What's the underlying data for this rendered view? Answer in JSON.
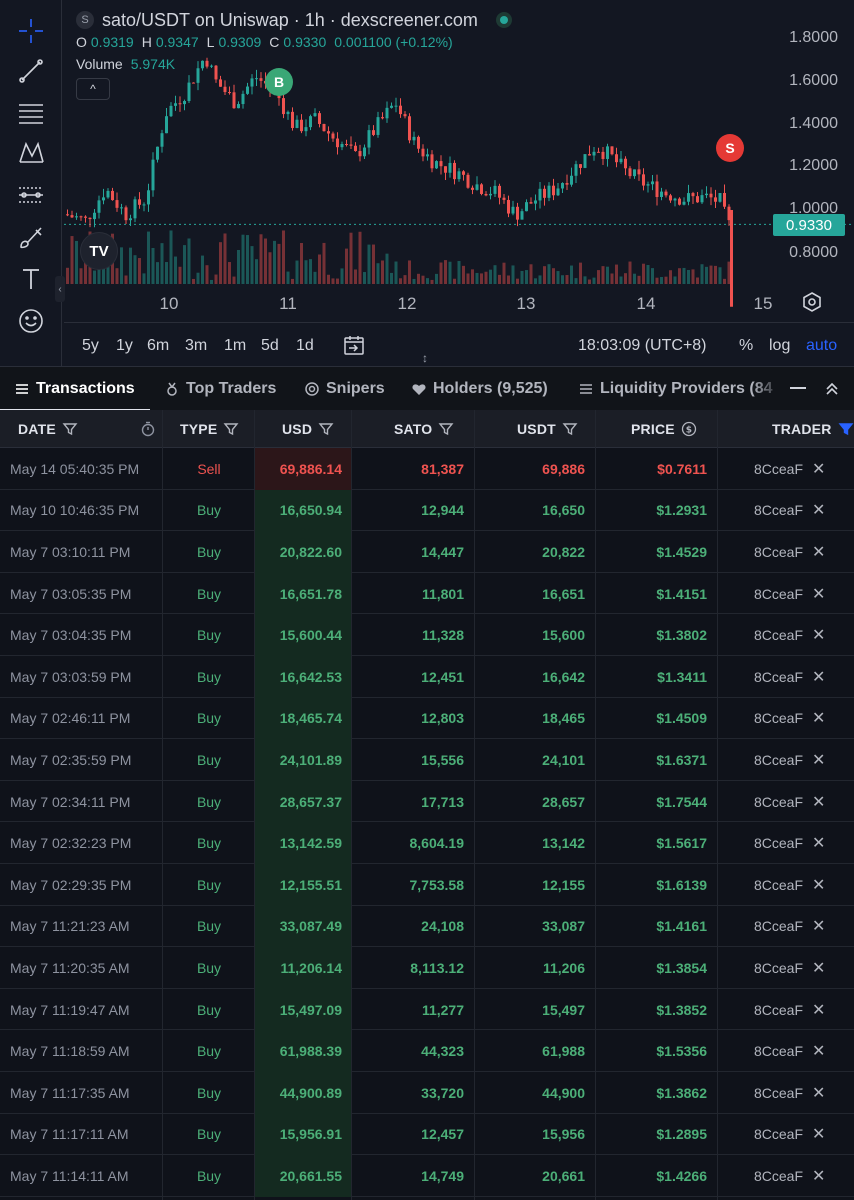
{
  "chart": {
    "title": "sato/USDT on Uniswap · 1h · dexscreener.com",
    "symbol_icon_letter": "S",
    "ohlc": [
      {
        "k": "O",
        "v": "0.9319"
      },
      {
        "k": "H",
        "v": "0.9347"
      },
      {
        "k": "L",
        "v": "0.9309"
      },
      {
        "k": "C",
        "v": "0.9330"
      },
      {
        "k": "",
        "v": "0.001100 (+0.12%)"
      }
    ],
    "volume_label": "Volume",
    "volume_value": "5.974K",
    "legend_toggle": "^",
    "logo_text": "TV",
    "y_axis": [
      "1.8000",
      "1.6000",
      "1.4000",
      "1.2000",
      "1.0000",
      "0.8000"
    ],
    "current_price": "0.9330",
    "x_axis": [
      "10",
      "11",
      "12",
      "13",
      "14",
      "15"
    ],
    "marker_buy": "B",
    "marker_sell": "S",
    "ranges": [
      "5y",
      "1y",
      "6m",
      "3m",
      "1m",
      "5d",
      "1d"
    ],
    "time": "18:03:09 (UTC+8)",
    "percent": "%",
    "log": "log",
    "auto": "auto",
    "colors": {
      "up": "#26a69a",
      "down": "#ef5350",
      "accent": "#2962ff"
    }
  },
  "tabs": [
    {
      "label": "Transactions",
      "icon": "transactions-icon"
    },
    {
      "label": "Top Traders",
      "icon": "medal-icon"
    },
    {
      "label": "Snipers",
      "icon": "target-icon"
    },
    {
      "label": "Holders (9,525)",
      "icon": "heart-icon"
    },
    {
      "label": "Liquidity Providers (84",
      "icon": "liquidity-icon"
    }
  ],
  "table": {
    "headers": [
      "DATE",
      "TYPE",
      "USD",
      "SATO",
      "USDT",
      "PRICE",
      "TRADER"
    ],
    "rows": [
      {
        "date": "May 14 05:40:35 PM",
        "type": "Sell",
        "usd": "69,886.14",
        "sato": "81,387",
        "usdt": "69,886",
        "price": "$0.7611",
        "trader": "8CceaF"
      },
      {
        "date": "May 10 10:46:35 PM",
        "type": "Buy",
        "usd": "16,650.94",
        "sato": "12,944",
        "usdt": "16,650",
        "price": "$1.2931",
        "trader": "8CceaF"
      },
      {
        "date": "May 7 03:10:11 PM",
        "type": "Buy",
        "usd": "20,822.60",
        "sato": "14,447",
        "usdt": "20,822",
        "price": "$1.4529",
        "trader": "8CceaF"
      },
      {
        "date": "May 7 03:05:35 PM",
        "type": "Buy",
        "usd": "16,651.78",
        "sato": "11,801",
        "usdt": "16,651",
        "price": "$1.4151",
        "trader": "8CceaF"
      },
      {
        "date": "May 7 03:04:35 PM",
        "type": "Buy",
        "usd": "15,600.44",
        "sato": "11,328",
        "usdt": "15,600",
        "price": "$1.3802",
        "trader": "8CceaF"
      },
      {
        "date": "May 7 03:03:59 PM",
        "type": "Buy",
        "usd": "16,642.53",
        "sato": "12,451",
        "usdt": "16,642",
        "price": "$1.3411",
        "trader": "8CceaF"
      },
      {
        "date": "May 7 02:46:11 PM",
        "type": "Buy",
        "usd": "18,465.74",
        "sato": "12,803",
        "usdt": "18,465",
        "price": "$1.4509",
        "trader": "8CceaF"
      },
      {
        "date": "May 7 02:35:59 PM",
        "type": "Buy",
        "usd": "24,101.89",
        "sato": "15,556",
        "usdt": "24,101",
        "price": "$1.6371",
        "trader": "8CceaF"
      },
      {
        "date": "May 7 02:34:11 PM",
        "type": "Buy",
        "usd": "28,657.37",
        "sato": "17,713",
        "usdt": "28,657",
        "price": "$1.7544",
        "trader": "8CceaF"
      },
      {
        "date": "May 7 02:32:23 PM",
        "type": "Buy",
        "usd": "13,142.59",
        "sato": "8,604.19",
        "usdt": "13,142",
        "price": "$1.5617",
        "trader": "8CceaF"
      },
      {
        "date": "May 7 02:29:35 PM",
        "type": "Buy",
        "usd": "12,155.51",
        "sato": "7,753.58",
        "usdt": "12,155",
        "price": "$1.6139",
        "trader": "8CceaF"
      },
      {
        "date": "May 7 11:21:23 AM",
        "type": "Buy",
        "usd": "33,087.49",
        "sato": "24,108",
        "usdt": "33,087",
        "price": "$1.4161",
        "trader": "8CceaF"
      },
      {
        "date": "May 7 11:20:35 AM",
        "type": "Buy",
        "usd": "11,206.14",
        "sato": "8,113.12",
        "usdt": "11,206",
        "price": "$1.3854",
        "trader": "8CceaF"
      },
      {
        "date": "May 7 11:19:47 AM",
        "type": "Buy",
        "usd": "15,497.09",
        "sato": "11,277",
        "usdt": "15,497",
        "price": "$1.3852",
        "trader": "8CceaF"
      },
      {
        "date": "May 7 11:18:59 AM",
        "type": "Buy",
        "usd": "61,988.39",
        "sato": "44,323",
        "usdt": "61,988",
        "price": "$1.5356",
        "trader": "8CceaF"
      },
      {
        "date": "May 7 11:17:35 AM",
        "type": "Buy",
        "usd": "44,900.89",
        "sato": "33,720",
        "usdt": "44,900",
        "price": "$1.3862",
        "trader": "8CceaF"
      },
      {
        "date": "May 7 11:17:11 AM",
        "type": "Buy",
        "usd": "15,956.91",
        "sato": "12,457",
        "usdt": "15,956",
        "price": "$1.2895",
        "trader": "8CceaF"
      },
      {
        "date": "May 7 11:14:11 AM",
        "type": "Buy",
        "usd": "20,661.55",
        "sato": "14,749",
        "usdt": "20,661",
        "price": "$1.4266",
        "trader": "8CceaF"
      }
    ],
    "remove_glyph": "✕"
  }
}
